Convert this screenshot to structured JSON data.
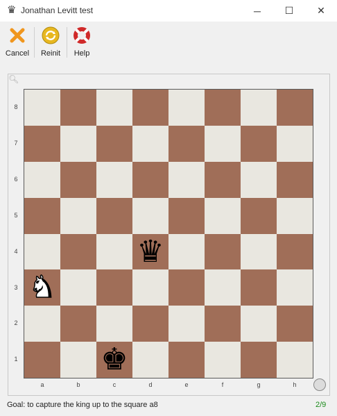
{
  "window": {
    "title": "Jonathan Levitt test",
    "icon": "chess-queen-icon",
    "controls": [
      "─",
      "☐",
      "✕"
    ]
  },
  "toolbar": {
    "cancel_label": "Cancel",
    "reinit_label": "Reinit",
    "help_label": "Help"
  },
  "board": {
    "ranks": [
      "8",
      "7",
      "6",
      "5",
      "4",
      "3",
      "2",
      "1"
    ],
    "files": [
      "a",
      "b",
      "c",
      "d",
      "e",
      "f",
      "g",
      "h"
    ],
    "light_color": "#e9e7e0",
    "dark_color": "#a06e58",
    "pieces": [
      {
        "square": "d4",
        "piece": "queen",
        "color": "black",
        "glyph": "♛"
      },
      {
        "square": "a3",
        "piece": "knight",
        "color": "white",
        "glyph": "♞"
      },
      {
        "square": "c1",
        "piece": "king",
        "color": "black",
        "glyph": "♚"
      }
    ]
  },
  "status": {
    "goal": "Goal: to capture the king up to the square a8",
    "progress": "2/9"
  }
}
